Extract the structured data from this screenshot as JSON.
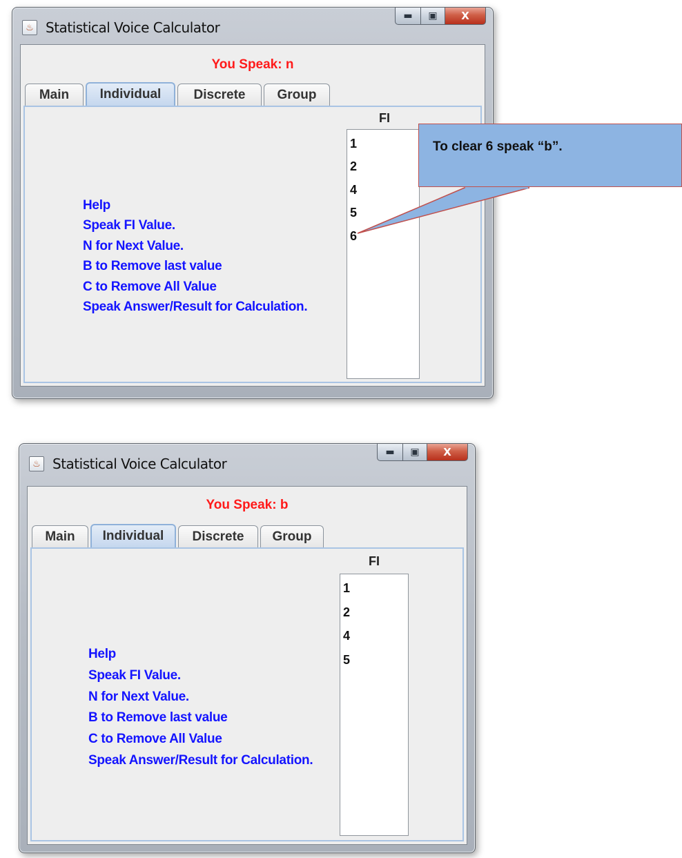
{
  "windows": [
    {
      "title": "Statistical Voice Calculator",
      "controls": {
        "minimize": "▬",
        "maximize": "▣",
        "close": "X"
      },
      "speak_label": "You Speak: n",
      "tabs": [
        "Main",
        "Individual",
        "Discrete",
        "Group"
      ],
      "selected_tab": "Individual",
      "help_lines": [
        "Help",
        "Speak FI Value.",
        "N for Next Value.",
        "B to Remove last value",
        "C to Remove All Value",
        "Speak Answer/Result for Calculation."
      ],
      "fi_header": "FI",
      "fi_values": [
        "1",
        "2",
        "4",
        "5",
        "6"
      ]
    },
    {
      "title": "Statistical Voice Calculator",
      "controls": {
        "minimize": "▬",
        "maximize": "▣",
        "close": "X"
      },
      "speak_label": "You Speak: b",
      "tabs": [
        "Main",
        "Individual",
        "Discrete",
        "Group"
      ],
      "selected_tab": "Individual",
      "help_lines": [
        "Help",
        "Speak FI Value.",
        "N for Next Value.",
        "B to Remove last value",
        "C to Remove All Value",
        "Speak Answer/Result for Calculation."
      ],
      "fi_header": "FI",
      "fi_values": [
        "1",
        "2",
        "4",
        "5"
      ]
    }
  ],
  "callout": {
    "text": "To clear 6 speak “b”.",
    "fill_color": "#8db4e2",
    "border_color": "#c0504d"
  },
  "colors": {
    "speak_label": "#ff1a1a",
    "help_text": "#1414ff",
    "selected_tab": "#c5d7ee"
  }
}
